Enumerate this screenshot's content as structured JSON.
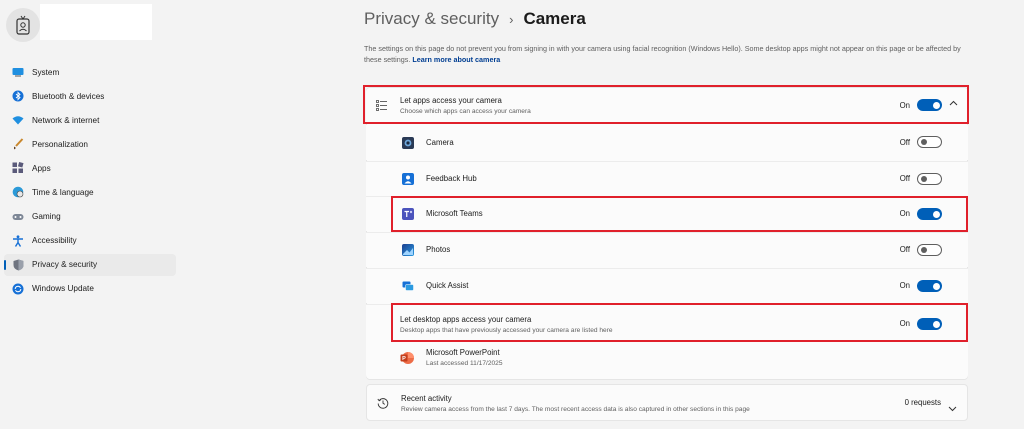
{
  "sidebar": {
    "items": [
      {
        "label": "System",
        "icon": "monitor-icon"
      },
      {
        "label": "Bluetooth & devices",
        "icon": "bluetooth-icon"
      },
      {
        "label": "Network & internet",
        "icon": "wifi-icon"
      },
      {
        "label": "Personalization",
        "icon": "brush-icon"
      },
      {
        "label": "Apps",
        "icon": "apps-icon"
      },
      {
        "label": "Time & language",
        "icon": "globe-clock-icon"
      },
      {
        "label": "Gaming",
        "icon": "gamepad-icon"
      },
      {
        "label": "Accessibility",
        "icon": "accessibility-icon"
      },
      {
        "label": "Privacy & security",
        "icon": "shield-icon",
        "active": true
      },
      {
        "label": "Windows Update",
        "icon": "update-icon"
      }
    ]
  },
  "header": {
    "crumb": "Privacy & security",
    "separator": "›",
    "current": "Camera"
  },
  "description": {
    "text": "The settings on this page do not prevent you from signing in with your camera using facial recognition (Windows Hello). Some desktop apps might not appear on this page or be affected by these settings.",
    "link": "Learn more about camera"
  },
  "main": {
    "app_access": {
      "title": "Let apps access your camera",
      "subtitle": "Choose which apps can access your camera",
      "state": "On"
    },
    "apps": [
      {
        "name": "Camera",
        "state": "Off",
        "on": false
      },
      {
        "name": "Feedback Hub",
        "state": "Off",
        "on": false
      },
      {
        "name": "Microsoft Teams",
        "state": "On",
        "on": true
      },
      {
        "name": "Photos",
        "state": "Off",
        "on": false
      },
      {
        "name": "Quick Assist",
        "state": "On",
        "on": true
      }
    ],
    "desktop_access": {
      "title": "Let desktop apps access your camera",
      "subtitle": "Desktop apps that have previously accessed your camera are listed here",
      "state": "On"
    },
    "desktop_apps": [
      {
        "name": "Microsoft PowerPoint",
        "detail": "Last accessed 11/17/2025"
      }
    ],
    "recent_activity": {
      "title": "Recent activity",
      "subtitle": "Review camera access from the last 7 days. The most recent access data is also captured in other sections in this page",
      "count": "0 requests"
    }
  },
  "colors": {
    "accent": "#005fb8",
    "highlight": "#e0202b",
    "background": "#f3f3f3",
    "card": "#fbfbfb"
  }
}
